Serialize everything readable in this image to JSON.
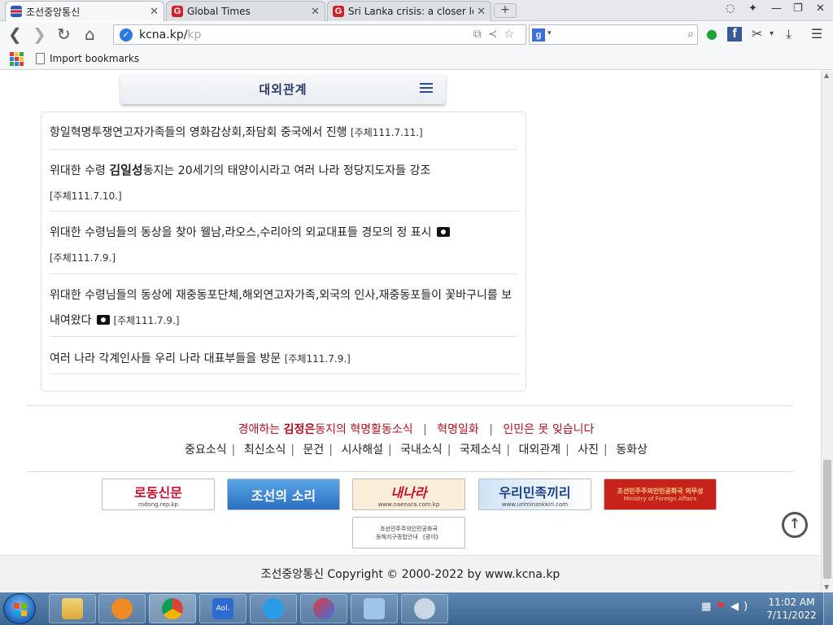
{
  "browser": {
    "tabs": [
      {
        "title": "조선중앙통신",
        "active": true
      },
      {
        "title": "Global Times",
        "active": false
      },
      {
        "title": "Sri Lanka crisis: a closer lo",
        "active": false
      }
    ],
    "url_host": "kcna.kp/",
    "url_path": "kp",
    "bookmark_label": "Import bookmarks"
  },
  "page": {
    "section_title": "대외관계",
    "news": [
      {
        "text": "항일혁명투쟁연고자가족들의 영화감상회,좌담회 중국에서 진행",
        "date": "[주체111.7.11.]",
        "camera": false
      },
      {
        "pre": "위대한 수령 ",
        "name": "김일성",
        "post": "동지는 20세기의 태양이시라고 여러 나라 정당지도자들 강조",
        "date": "[주체111.7.10.]",
        "camera": false
      },
      {
        "text": "위대한 수령님들의 동상을 찾아 웰남,라오스,수리아의 외교대표들 경모의 정 표시",
        "date": "[주체111.7.9.]",
        "camera": true
      },
      {
        "text": "위대한 수령님들의 동상에 재중동포단체,해외연고자가족,외국의 인사,재중동포들이 꽃바구니를 보내여왔다",
        "date": "[주체111.7.9.]",
        "camera": true
      },
      {
        "text": "여러 나라 각계인사들 우리 나라 대표부들을 방문",
        "date": "[주체111.7.9.]",
        "camera": false
      }
    ],
    "footer_links_primary": {
      "first_pre": "경애하는 ",
      "first_name": "김정은",
      "first_post": "동지의 혁명활동소식",
      "second": "혁명일화",
      "third": "인민은 못 잊습니다"
    },
    "footer_links_secondary": [
      "중요소식",
      "최신소식",
      "문건",
      "시사해설",
      "국내소식",
      "국제소식",
      "대외관계",
      "사진",
      "동화상"
    ],
    "banners": [
      {
        "title": "로동신문",
        "sub": "rodong.rep.kp"
      },
      {
        "title": "조선의 소리",
        "sub": ""
      },
      {
        "title": "내나라",
        "sub": "www.naenara.com.kp"
      },
      {
        "title": "우리민족끼리",
        "sub": "www.uriminzokkiri.com"
      },
      {
        "title": "조선민주주의인민공화국 외무성",
        "sub": "Ministry of Foreign Affairs"
      },
      {
        "title": "조선민주주의인민공화국",
        "sub": "동해지구종합안내 《광야》"
      }
    ],
    "copyright": "조선중앙통신 Copyright © 2000-2022 by www.kcna.kp"
  },
  "taskbar": {
    "time": "11:02 AM",
    "date": "7/11/2022"
  }
}
